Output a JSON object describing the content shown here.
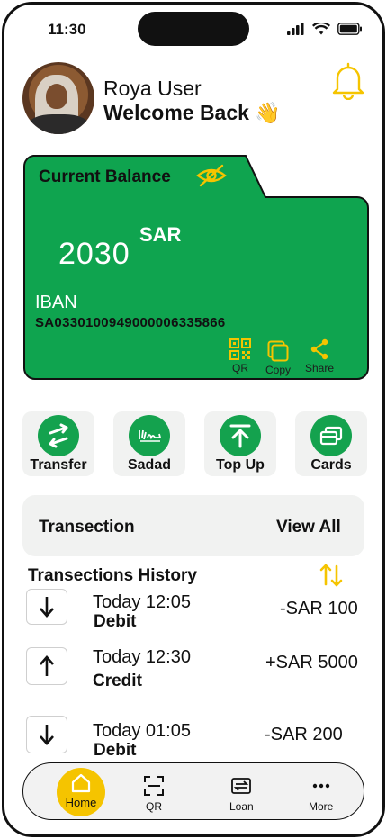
{
  "status_bar": {
    "time": "11:30"
  },
  "header": {
    "user_name": "Roya User",
    "welcome": "Welcome Back 👋"
  },
  "balance_card": {
    "title": "Current Balance",
    "amount": "2030",
    "currency": "SAR",
    "iban_label": "IBAN",
    "iban": "SA0330100949000006335866",
    "actions": {
      "qr": "QR",
      "copy": "Copy",
      "share": "Share"
    }
  },
  "quick_actions": [
    {
      "label": "Transfer",
      "icon": "transfer-icon"
    },
    {
      "label": "Sadad",
      "icon": "sadad-icon"
    },
    {
      "label": "Top Up",
      "icon": "top-up-icon"
    },
    {
      "label": "Cards",
      "icon": "cards-icon"
    }
  ],
  "transactions": {
    "title": "Transection",
    "view_all": "View All",
    "history_title": "Transections History",
    "items": [
      {
        "direction": "down",
        "time": "Today 12:05",
        "type": "Debit",
        "amount": "-SAR 100"
      },
      {
        "direction": "up",
        "time": "Today 12:30",
        "type": "Credit",
        "amount": "+SAR 5000"
      },
      {
        "direction": "down",
        "time": "Today 01:05",
        "type": "Debit",
        "amount": "-SAR 200"
      }
    ]
  },
  "bottom_nav": {
    "items": [
      {
        "label": "Home",
        "icon": "home-icon",
        "active": true
      },
      {
        "label": "QR",
        "icon": "qr-scan-icon"
      },
      {
        "label": "Loan",
        "icon": "loan-icon"
      },
      {
        "label": "More",
        "icon": "more-icon"
      }
    ]
  },
  "colors": {
    "brand_green": "#0FA44F",
    "accent_yellow": "#F5C400",
    "card_dark_text": "#111111"
  }
}
